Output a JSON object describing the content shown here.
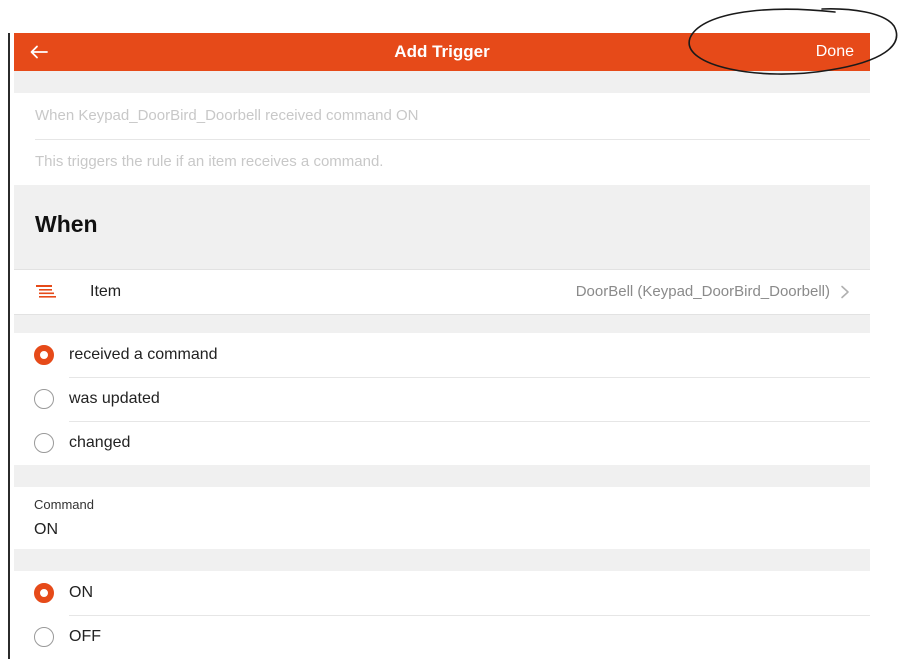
{
  "header": {
    "title": "Add Trigger",
    "done_label": "Done",
    "accent_color": "#e64a19"
  },
  "summary": {
    "description": "When Keypad_DoorBird_Doorbell received command ON",
    "hint": "This triggers the rule if an item receives a command."
  },
  "when": {
    "heading": "When",
    "item_label": "Item",
    "item_value": "DoorBell (Keypad_DoorBird_Doorbell)",
    "item_icon": "list-icon"
  },
  "event_options": [
    {
      "label": "received a command",
      "selected": true
    },
    {
      "label": "was updated",
      "selected": false
    },
    {
      "label": "changed",
      "selected": false
    }
  ],
  "command": {
    "label": "Command",
    "value": "ON"
  },
  "command_options": [
    {
      "label": "ON",
      "selected": true
    },
    {
      "label": "OFF",
      "selected": false
    }
  ]
}
